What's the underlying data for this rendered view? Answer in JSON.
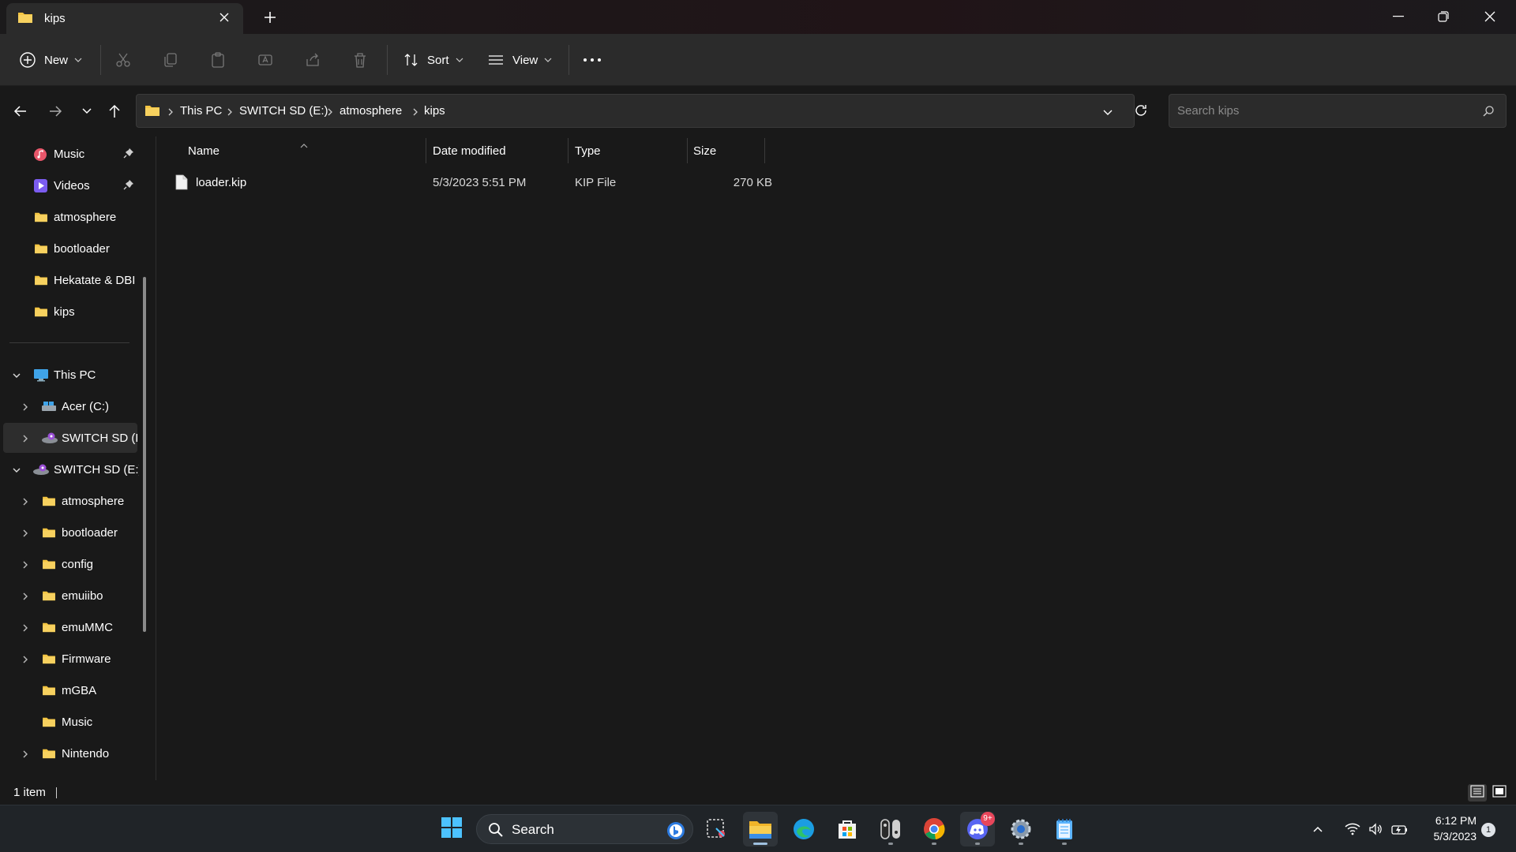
{
  "window": {
    "tab_title": "kips",
    "minimize": "minimize",
    "maximize": "restore",
    "close": "close"
  },
  "command_bar": {
    "new_label": "New",
    "sort_label": "Sort",
    "view_label": "View"
  },
  "address": {
    "breadcrumbs": [
      "This PC",
      "SWITCH SD (E:)",
      "atmosphere",
      "kips"
    ],
    "search_placeholder": "Search kips"
  },
  "sidebar": {
    "quick_access": [
      {
        "label": "Music",
        "icon": "music-icon",
        "pinned": true
      },
      {
        "label": "Videos",
        "icon": "videos-icon",
        "pinned": true
      },
      {
        "label": "atmosphere",
        "icon": "folder-icon"
      },
      {
        "label": "bootloader",
        "icon": "folder-icon"
      },
      {
        "label": "Hekatate & DBI",
        "icon": "folder-icon"
      },
      {
        "label": "kips",
        "icon": "folder-icon"
      }
    ],
    "this_pc": "This PC",
    "drives": [
      "Acer (C:)",
      "SWITCH SD (E:)"
    ],
    "switch_drive": "SWITCH SD (E:)",
    "switch_folders": [
      "atmosphere",
      "bootloader",
      "config",
      "emuiibo",
      "emuMMC",
      "Firmware",
      "mGBA",
      "Music",
      "Nintendo"
    ]
  },
  "columns": {
    "name": "Name",
    "date": "Date modified",
    "type": "Type",
    "size": "Size"
  },
  "files": [
    {
      "name": "loader.kip",
      "date": "5/3/2023 5:51 PM",
      "type": "KIP File",
      "size": "270 KB"
    }
  ],
  "status": {
    "count": "1 item"
  },
  "taskbar": {
    "search_label": "Search",
    "discord_badge": "9+",
    "time": "6:12 PM",
    "date": "5/3/2023",
    "notification_count": "1"
  },
  "colors": {
    "accent": "#4cc2ff",
    "folder": "#f4c542",
    "background": "#191919",
    "toolbar": "#2b2b2b"
  }
}
